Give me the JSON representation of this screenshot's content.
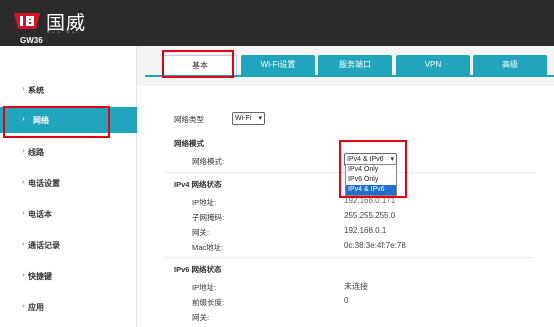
{
  "header": {
    "brand_name": "国威",
    "brand_sub": "GUO WEI",
    "model": "GW36"
  },
  "sidebar": {
    "items": [
      {
        "label": "系统"
      },
      {
        "label": "网络"
      },
      {
        "label": "线路"
      },
      {
        "label": "电话设置"
      },
      {
        "label": "电话本"
      },
      {
        "label": "通话记录"
      },
      {
        "label": "快捷键"
      },
      {
        "label": "应用"
      }
    ]
  },
  "tabs": [
    {
      "label": "基本"
    },
    {
      "label": "Wi-Fi设置"
    },
    {
      "label": "服务端口"
    },
    {
      "label": "VPN"
    },
    {
      "label": "高级"
    }
  ],
  "network_type": {
    "label": "网络类型",
    "value": "Wi-Fi"
  },
  "network_mode": {
    "section": "网络模式",
    "label": "网络模式:",
    "value": "IPv4 & IPv6",
    "options": [
      "IPv4 Only",
      "IPv6 Only",
      "IPv4 & IPv6"
    ],
    "selected_index": 2
  },
  "ipv4": {
    "section": "IPv4 网络状态",
    "ip_label": "IP地址:",
    "ip_value": "192.168.0.171",
    "mask_label": "子网掩码:",
    "mask_value": "255.255.255.0",
    "gw_label": "网关:",
    "gw_value": "192.168.0.1",
    "mac_label": "Mac地址:",
    "mac_value": "0c:38:3e:4f:7e:78"
  },
  "ipv6": {
    "section": "IPv6 网络状态",
    "ip_label": "IP地址:",
    "ip_value": "未连接",
    "prefix_label": "前缀长度:",
    "prefix_value": "0",
    "gw_label": "网关:"
  },
  "colors": {
    "accent": "#20a5bc",
    "header": "#2b2b2b",
    "highlight": "#e60012",
    "option_selected": "#1f6fd1"
  }
}
